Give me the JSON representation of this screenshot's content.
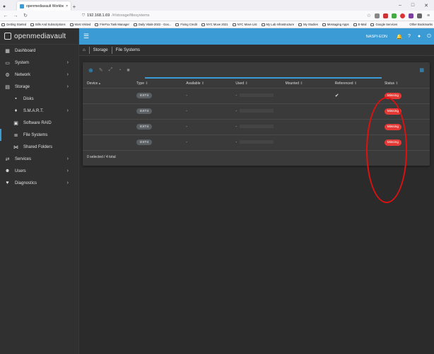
{
  "browser": {
    "tab_title": "openmediavault Workbench",
    "url_host": "192.168.1.69",
    "url_path": "/#/storage/filesystems",
    "bookmarks": [
      "Getting Started",
      "Bills And Subscriptions",
      "Most Visited",
      "FireFox Task Manager",
      "Daily Vitals-2022 - Goo...",
      "Fixing Credit",
      "NYC Move 2021",
      "NYC Move List",
      "My Lab Infrastructure",
      "My Studies",
      "Messaging Apps",
      "E-Mail",
      "Google Services"
    ],
    "other_bookmarks": "Other Bookmarks"
  },
  "app": {
    "brand": "openmediavault",
    "hostname": "NASPI-EON",
    "sidebar": [
      {
        "label": "Dashboard",
        "icon": "dashboard-icon",
        "chev": false,
        "sub": false
      },
      {
        "label": "System",
        "icon": "system-icon",
        "chev": true,
        "sub": false
      },
      {
        "label": "Network",
        "icon": "network-icon",
        "chev": true,
        "sub": false
      },
      {
        "label": "Storage",
        "icon": "storage-icon",
        "chev": true,
        "sub": false
      },
      {
        "label": "Disks",
        "icon": "disk-icon",
        "chev": false,
        "sub": true
      },
      {
        "label": "S.M.A.R.T.",
        "icon": "smart-icon",
        "chev": true,
        "sub": true
      },
      {
        "label": "Software RAID",
        "icon": "raid-icon",
        "chev": false,
        "sub": true
      },
      {
        "label": "File Systems",
        "icon": "filesystems-icon",
        "chev": false,
        "sub": true,
        "active": true
      },
      {
        "label": "Shared Folders",
        "icon": "share-icon",
        "chev": false,
        "sub": true
      },
      {
        "label": "Services",
        "icon": "services-icon",
        "chev": true,
        "sub": false
      },
      {
        "label": "Users",
        "icon": "users-icon",
        "chev": true,
        "sub": false
      },
      {
        "label": "Diagnostics",
        "icon": "diagnostics-icon",
        "chev": true,
        "sub": false
      }
    ],
    "breadcrumb": {
      "first": "Storage",
      "second": "File Systems"
    }
  },
  "table": {
    "columns": [
      "Device",
      "Type",
      "Available",
      "Used",
      "Mounted",
      "Referenced",
      "Status"
    ],
    "rows": [
      {
        "type": "EXT4",
        "available": "-",
        "used": "-",
        "referenced": "✔",
        "status": "Missing"
      },
      {
        "type": "EXT4",
        "available": "-",
        "used": "-",
        "referenced": "",
        "status": "Missing"
      },
      {
        "type": "EXT4",
        "available": "-",
        "used": "-",
        "referenced": "",
        "status": "Missing"
      },
      {
        "type": "EXT4",
        "available": "-",
        "used": "-",
        "referenced": "",
        "status": "Missing"
      }
    ],
    "footer": "0 selected / 4 total"
  },
  "colors": {
    "accent": "#3a9bd5",
    "missing": "#e53935",
    "annotation": "#dd1111"
  }
}
